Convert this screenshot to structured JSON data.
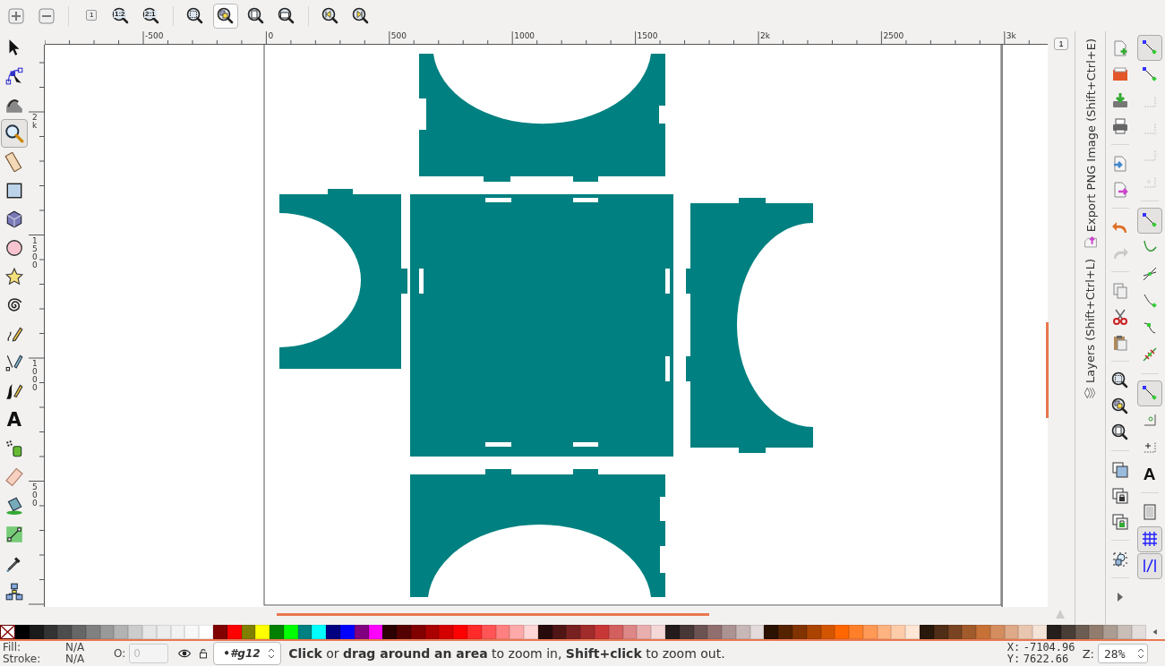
{
  "zoom_toolbar": [
    {
      "selected": false
    },
    {
      "selected": false
    },
    {
      "glyph": "1",
      "selected": false
    },
    {
      "glyph": "1:2",
      "selected": false
    },
    {
      "glyph": "2:1",
      "selected": false
    },
    {
      "selected": false
    },
    {
      "selected": true
    },
    {
      "selected": false
    },
    {
      "selected": false
    },
    {
      "selected": false
    },
    {
      "selected": false
    }
  ],
  "tools": [
    {
      "selected": false
    },
    {
      "selected": false
    },
    {
      "selected": false
    },
    {
      "selected": true
    },
    {
      "selected": false
    },
    {
      "selected": false
    },
    {
      "selected": false
    },
    {
      "selected": false
    },
    {
      "selected": false
    },
    {
      "selected": false
    },
    {
      "selected": false
    },
    {
      "selected": false
    },
    {
      "selected": false
    },
    {
      "glyph": "A",
      "selected": false
    },
    {
      "selected": false
    },
    {
      "selected": false
    },
    {
      "selected": false
    },
    {
      "selected": false
    },
    {
      "selected": false
    },
    {
      "selected": false
    }
  ],
  "h_ruler": [
    "-500",
    "0",
    "500",
    "1000",
    "1500",
    "2k",
    "2500",
    "3k"
  ],
  "v_ruler": [
    "2k",
    "1500",
    "1000",
    "500"
  ],
  "zoom_1to1_button": "1",
  "dock_tabs": [
    "Export PNG Image (Shift+Ctrl+E)",
    "Layers (Shift+Ctrl+L)"
  ],
  "commands": [
    {
      "disabled": false
    },
    {
      "disabled": false
    },
    {
      "disabled": false
    },
    {
      "disabled": false
    },
    {
      "disabled": false
    },
    {
      "disabled": false
    },
    {
      "disabled": false
    },
    {
      "disabled": true
    },
    {
      "disabled": false
    },
    {
      "disabled": false
    },
    {
      "disabled": false
    },
    {
      "disabled": false
    },
    {
      "disabled": false
    },
    {
      "disabled": false
    },
    {
      "disabled": false
    },
    {
      "disabled": false
    },
    {
      "disabled": false
    },
    {
      "disabled": false
    },
    {
      "disabled": false
    }
  ],
  "snaps": [
    {
      "on": true,
      "disabled": false
    },
    {
      "on": false,
      "disabled": false
    },
    {
      "on": false,
      "disabled": true
    },
    {
      "on": false,
      "disabled": true
    },
    {
      "on": false,
      "disabled": true
    },
    {
      "on": false,
      "disabled": true
    },
    {
      "on": true,
      "disabled": false
    },
    {
      "on": false,
      "disabled": false
    },
    {
      "on": false,
      "disabled": false
    },
    {
      "on": false,
      "disabled": false
    },
    {
      "on": false,
      "disabled": false
    },
    {
      "on": false,
      "disabled": false
    },
    {
      "on": true,
      "disabled": false
    },
    {
      "on": false,
      "disabled": false
    },
    {
      "on": false,
      "disabled": false
    },
    {
      "glyph": "A",
      "on": false,
      "disabled": false
    },
    {
      "on": false,
      "disabled": false
    },
    {
      "on": true,
      "disabled": false
    },
    {
      "on": true,
      "disabled": false
    }
  ],
  "palette": [
    {
      "color": "#000000"
    },
    {
      "color": "#1a1a1a"
    },
    {
      "color": "#333333"
    },
    {
      "color": "#4d4d4d"
    },
    {
      "color": "#666666"
    },
    {
      "color": "#808080"
    },
    {
      "color": "#999999"
    },
    {
      "color": "#b3b3b3"
    },
    {
      "color": "#cccccc"
    },
    {
      "color": "#e6e6e6"
    },
    {
      "color": "#ececec"
    },
    {
      "color": "#f2f2f2"
    },
    {
      "color": "#f8f8f8"
    },
    {
      "color": "#ffffff"
    },
    {
      "color": "#800000"
    },
    {
      "color": "#ff0000"
    },
    {
      "color": "#808000"
    },
    {
      "color": "#ffff00"
    },
    {
      "color": "#008000"
    },
    {
      "color": "#00ff00"
    },
    {
      "color": "#008080"
    },
    {
      "color": "#00ffff"
    },
    {
      "color": "#000080"
    },
    {
      "color": "#0000ff"
    },
    {
      "color": "#800080"
    },
    {
      "color": "#ff00ff"
    },
    {
      "color": "#2b0000"
    },
    {
      "color": "#550000"
    },
    {
      "color": "#800000"
    },
    {
      "color": "#aa0000"
    },
    {
      "color": "#d40000"
    },
    {
      "color": "#ff0000"
    },
    {
      "color": "#ff2a2a"
    },
    {
      "color": "#ff5555"
    },
    {
      "color": "#ff8080"
    },
    {
      "color": "#ffaaaa"
    },
    {
      "color": "#ffd5d5"
    },
    {
      "color": "#280b0b"
    },
    {
      "color": "#501616"
    },
    {
      "color": "#782121"
    },
    {
      "color": "#a02c2c"
    },
    {
      "color": "#c83737"
    },
    {
      "color": "#d35f5f"
    },
    {
      "color": "#de8787"
    },
    {
      "color": "#e9afaf"
    },
    {
      "color": "#f4d7d7"
    },
    {
      "color": "#241c1c"
    },
    {
      "color": "#483737"
    },
    {
      "color": "#6c5353"
    },
    {
      "color": "#916f6f"
    },
    {
      "color": "#ac9393"
    },
    {
      "color": "#c8b7b7"
    },
    {
      "color": "#e3dbdb"
    },
    {
      "color": "#2b1100"
    },
    {
      "color": "#552200"
    },
    {
      "color": "#803300"
    },
    {
      "color": "#aa4400"
    },
    {
      "color": "#d45500"
    },
    {
      "color": "#ff6600"
    },
    {
      "color": "#ff7f2a"
    },
    {
      "color": "#ff9955"
    },
    {
      "color": "#ffb380"
    },
    {
      "color": "#ffccaa"
    },
    {
      "color": "#ffe6d5"
    },
    {
      "color": "#28170b"
    },
    {
      "color": "#502d16"
    },
    {
      "color": "#784421"
    },
    {
      "color": "#a05a2c"
    },
    {
      "color": "#c87137"
    },
    {
      "color": "#d38d5f"
    },
    {
      "color": "#deaa87"
    },
    {
      "color": "#e9c6af"
    },
    {
      "color": "#f4e3d7"
    },
    {
      "color": "#241f1c"
    },
    {
      "color": "#483e37"
    },
    {
      "color": "#6c5d53"
    },
    {
      "color": "#917c6f"
    },
    {
      "color": "#ac9d93"
    },
    {
      "color": "#c8beb7"
    },
    {
      "color": "#e3dedb"
    }
  ],
  "status": {
    "fill_label": "Fill:",
    "fill_value": "N/A",
    "stroke_label": "Stroke:",
    "stroke_value": "N/A",
    "opacity_label": "O:",
    "opacity_value": "0",
    "opacity_disabled": true,
    "layer": "•#g12",
    "message": "**Click** or **drag around an area** to zoom in, **Shift+click** to zoom out.",
    "x_label": "X:",
    "x_value": "-7104.96",
    "y_label": "Y:",
    "y_value": "7622.66",
    "zoom_label": "Z:",
    "zoom_value": "28%"
  }
}
